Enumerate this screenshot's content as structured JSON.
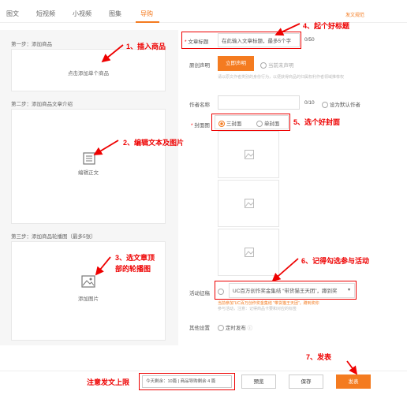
{
  "tabs": [
    {
      "label": "图文"
    },
    {
      "label": "短视频"
    },
    {
      "label": "小视频"
    },
    {
      "label": "图集"
    },
    {
      "label": "导购"
    }
  ],
  "help_link": "发文规范",
  "left": {
    "step1_label": "第一步：添加商品",
    "add_product": "点击添加单个商品",
    "step2_label": "第二步：添加商品文章介绍",
    "edit_body": "编辑正文",
    "step3_label": "第三步：添加商品轮播图（最多5张）",
    "add_image": "添加图片"
  },
  "form": {
    "title_label": "文章标题",
    "title_placeholder": "在此输入文章标题，最多5个字",
    "title_count": "0/50",
    "original_label": "原创声明",
    "original_button": "立即声明",
    "original_status": "当前未声明",
    "original_hint": "请以原文作者类别的身份行为，以便获得商品的归属权利作者领域推荐权",
    "author_label": "作者名称",
    "author_count": "0/10",
    "default_author": "设为默认作者",
    "cover_label": "封面图",
    "cover_three": "三封面",
    "cover_single": "单封面",
    "activity_label": "活动征稿",
    "activity_value": "UC百万创作奖金集结 “带货猫王天团”，蹲到奖",
    "activity_hint_a": "当前参加“UC百万创作奖金集结 “带货猫王天团”，蹲到奖你",
    "activity_hint_b": "参与活动，注意：记得商品卡要和对应的标签",
    "other_label": "其他设置",
    "schedule": "定时发布"
  },
  "bottom": {
    "quota": "今天剩余：10篇 | 商品导购剩余 4 篇",
    "preview": "预览",
    "save": "保存",
    "publish": "发表"
  },
  "annotations": {
    "a1": "1、插入商品",
    "a2": "2、编辑文本及图片",
    "a3_line1": "3、选文章顶",
    "a3_line2": "部的轮播图",
    "a4": "4、起个好标题",
    "a5": "5、选个好封面",
    "a6": "6、记得勾选参与活动",
    "a7": "7、发表",
    "a8": "注意发文上限"
  },
  "colors": {
    "accent": "#f47b20",
    "annotation": "#ee0000"
  }
}
